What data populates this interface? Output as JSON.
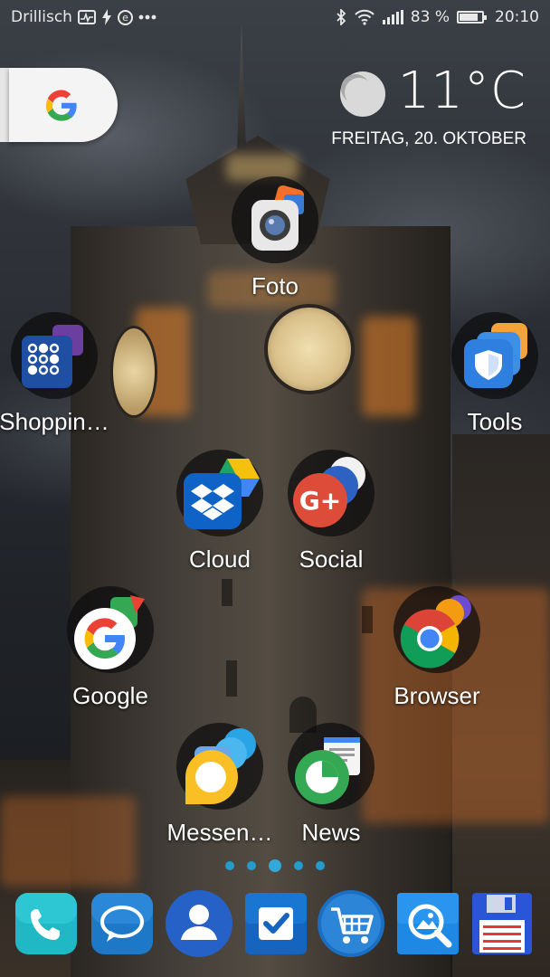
{
  "status_bar": {
    "carrier": "Drillisch",
    "battery": "83 %",
    "battery_level": 0.83,
    "time": "20:10",
    "icons": [
      "activity-icon",
      "charging-icon",
      "eco-icon",
      "more-icon",
      "bluetooth-icon",
      "wifi-icon",
      "signal-icon",
      "battery-icon"
    ]
  },
  "search_widget": {
    "icon": "google-g-icon"
  },
  "weather": {
    "temperature": "11°C",
    "date": "FREITAG, 20. OKTOBER",
    "icon": "moon-icon"
  },
  "apps": [
    {
      "label": "Foto",
      "icon": "camera-icon"
    },
    {
      "label": "Shoppin…",
      "icon": "shopping-folder-icon"
    },
    {
      "label": "Tools",
      "icon": "tools-folder-icon"
    },
    {
      "label": "Cloud",
      "icon": "dropbox-icon"
    },
    {
      "label": "Social",
      "icon": "google-plus-icon"
    },
    {
      "label": "Google",
      "icon": "google-folder-icon"
    },
    {
      "label": "Browser",
      "icon": "chrome-icon"
    },
    {
      "label": "Messen…",
      "icon": "allo-icon"
    },
    {
      "label": "News",
      "icon": "news-icon"
    }
  ],
  "page_indicator": {
    "pages": 5,
    "current": 3
  },
  "dock": [
    {
      "name": "phone",
      "icon": "phone-icon"
    },
    {
      "name": "messages",
      "icon": "message-icon"
    },
    {
      "name": "contacts",
      "icon": "contacts-icon"
    },
    {
      "name": "tasks",
      "icon": "checkmark-icon"
    },
    {
      "name": "shop",
      "icon": "cart-icon"
    },
    {
      "name": "gallery",
      "icon": "gallery-icon"
    },
    {
      "name": "save",
      "icon": "floppy-icon"
    }
  ],
  "colors": {
    "accent": "#31b3ea",
    "google_blue": "#4285f4",
    "google_red": "#ea4335",
    "google_yellow": "#fbbc05",
    "google_green": "#34a853"
  }
}
